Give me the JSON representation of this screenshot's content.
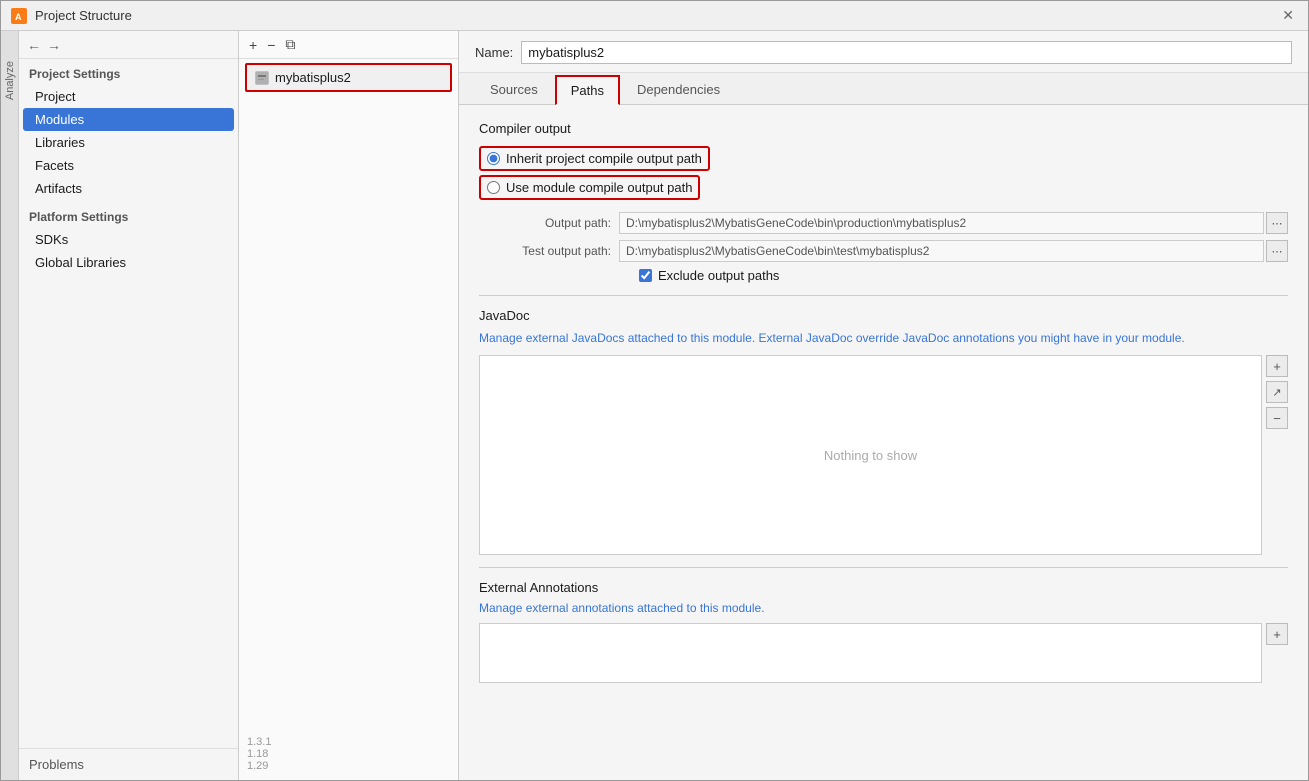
{
  "window": {
    "title": "Project Structure",
    "icon_text": "A"
  },
  "sidebar": {
    "project_settings_label": "Project Settings",
    "items": [
      {
        "id": "project",
        "label": "Project"
      },
      {
        "id": "modules",
        "label": "Modules",
        "active": true
      },
      {
        "id": "libraries",
        "label": "Libraries"
      },
      {
        "id": "facets",
        "label": "Facets"
      },
      {
        "id": "artifacts",
        "label": "Artifacts"
      }
    ],
    "platform_settings_label": "Platform Settings",
    "platform_items": [
      {
        "id": "sdks",
        "label": "SDKs"
      },
      {
        "id": "global-libraries",
        "label": "Global Libraries"
      }
    ],
    "problems_label": "Problems"
  },
  "module_list": {
    "toolbar": {
      "add_label": "+",
      "remove_label": "−",
      "copy_label": "⧉"
    },
    "items": [
      {
        "id": "mybatisplus2",
        "label": "mybatisplus2"
      }
    ]
  },
  "main": {
    "name_label": "Name:",
    "name_value": "mybatisplus2",
    "tabs": [
      {
        "id": "sources",
        "label": "Sources"
      },
      {
        "id": "paths",
        "label": "Paths",
        "active": true
      },
      {
        "id": "dependencies",
        "label": "Dependencies"
      }
    ],
    "compiler_output": {
      "section_title": "Compiler output",
      "radio_inherit": "Inherit project compile output path",
      "radio_use_module": "Use module compile output path",
      "output_path_label": "Output path:",
      "output_path_value": "D:\\mybatisplus2\\MybatisGeneCode\\bin\\production\\mybatisplus2",
      "test_output_path_label": "Test output path:",
      "test_output_path_value": "D:\\mybatisplus2\\MybatisGeneCode\\bin\\test\\mybatisplus2",
      "exclude_checkbox_label": "Exclude output paths",
      "exclude_checked": true
    },
    "javadoc": {
      "title": "JavaDoc",
      "description": "Manage external JavaDocs attached to this module. External JavaDoc override JavaDoc annotations you might have in your module.",
      "nothing_to_show": "Nothing to show",
      "buttons": [
        "+",
        "↗",
        "−"
      ]
    },
    "external_annotations": {
      "title": "External Annotations",
      "description": "Manage external annotations attached to this module.",
      "button_add": "+"
    }
  },
  "versions": {
    "v1": "1.3.1",
    "v2": "1.18",
    "v3": "1.29"
  }
}
